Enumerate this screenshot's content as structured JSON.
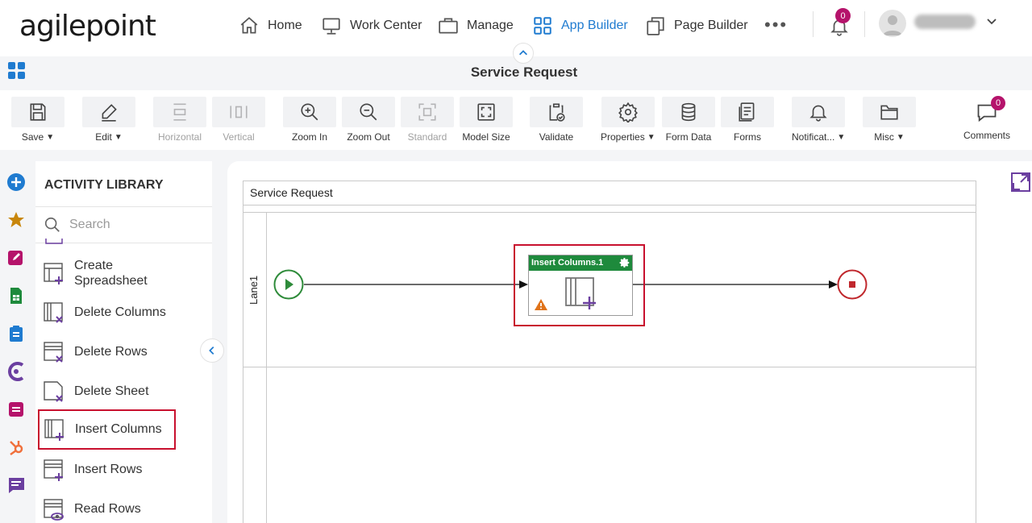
{
  "brand": {
    "logo_text": "agilepoint"
  },
  "nav": {
    "items": [
      {
        "label": "Home",
        "icon": "home-icon"
      },
      {
        "label": "Work Center",
        "icon": "monitor-icon"
      },
      {
        "label": "Manage",
        "icon": "briefcase-icon"
      },
      {
        "label": "App Builder",
        "icon": "grid-icon",
        "active": true
      },
      {
        "label": "Page Builder",
        "icon": "pages-icon"
      }
    ],
    "more": "•••",
    "notifications_count": "0"
  },
  "page": {
    "title": "Service Request"
  },
  "toolbar": {
    "tools": [
      {
        "label": "Save",
        "icon": "save-icon",
        "dropdown": true,
        "disabled": false
      },
      {
        "label": "Edit",
        "icon": "pencil-icon",
        "dropdown": true,
        "disabled": false
      },
      {
        "label": "Horizontal",
        "icon": "horizontal-icon",
        "dropdown": false,
        "disabled": true
      },
      {
        "label": "Vertical",
        "icon": "vertical-icon",
        "dropdown": false,
        "disabled": true
      },
      {
        "label": "Zoom In",
        "icon": "zoom-in-icon",
        "dropdown": false,
        "disabled": false
      },
      {
        "label": "Zoom Out",
        "icon": "zoom-out-icon",
        "dropdown": false,
        "disabled": false
      },
      {
        "label": "Standard",
        "icon": "standard-icon",
        "dropdown": false,
        "disabled": true
      },
      {
        "label": "Model Size",
        "icon": "model-size-icon",
        "dropdown": false,
        "disabled": false
      },
      {
        "label": "Validate",
        "icon": "validate-icon",
        "dropdown": false,
        "disabled": false
      },
      {
        "label": "Properties",
        "icon": "gear-icon",
        "dropdown": true,
        "disabled": false
      },
      {
        "label": "Form Data",
        "icon": "database-icon",
        "dropdown": false,
        "disabled": false
      },
      {
        "label": "Forms",
        "icon": "forms-icon",
        "dropdown": false,
        "disabled": false
      },
      {
        "label": "Notificat...",
        "icon": "bell-icon",
        "dropdown": true,
        "disabled": false
      },
      {
        "label": "Misc",
        "icon": "folder-icon",
        "dropdown": true,
        "disabled": false
      }
    ],
    "comments": {
      "label": "Comments",
      "count": "0"
    }
  },
  "library": {
    "title": "ACTIVITY LIBRARY",
    "search_placeholder": "Search",
    "items": [
      {
        "label": "Create\nSpreadsheet",
        "icon": "create-spreadsheet-icon"
      },
      {
        "label": "Delete Columns",
        "icon": "delete-columns-icon"
      },
      {
        "label": "Delete Rows",
        "icon": "delete-rows-icon"
      },
      {
        "label": "Delete Sheet",
        "icon": "delete-sheet-icon"
      },
      {
        "label": "Insert Columns",
        "icon": "insert-columns-icon",
        "highlighted": true
      },
      {
        "label": "Insert Rows",
        "icon": "insert-rows-icon"
      },
      {
        "label": "Read Rows",
        "icon": "read-rows-icon"
      }
    ]
  },
  "process": {
    "pool_title": "Service Request",
    "lane_label": "Lane1",
    "activity": {
      "title": "Insert Columns.1",
      "warning": true
    }
  },
  "colors": {
    "accent": "#1f7bd0",
    "activity_header": "#1e8a3c",
    "highlight": "#c8102e",
    "badge": "#b5136b",
    "start_event": "#2e8b3a",
    "end_event": "#c0282d",
    "icon_purple": "#6b3fa0"
  }
}
